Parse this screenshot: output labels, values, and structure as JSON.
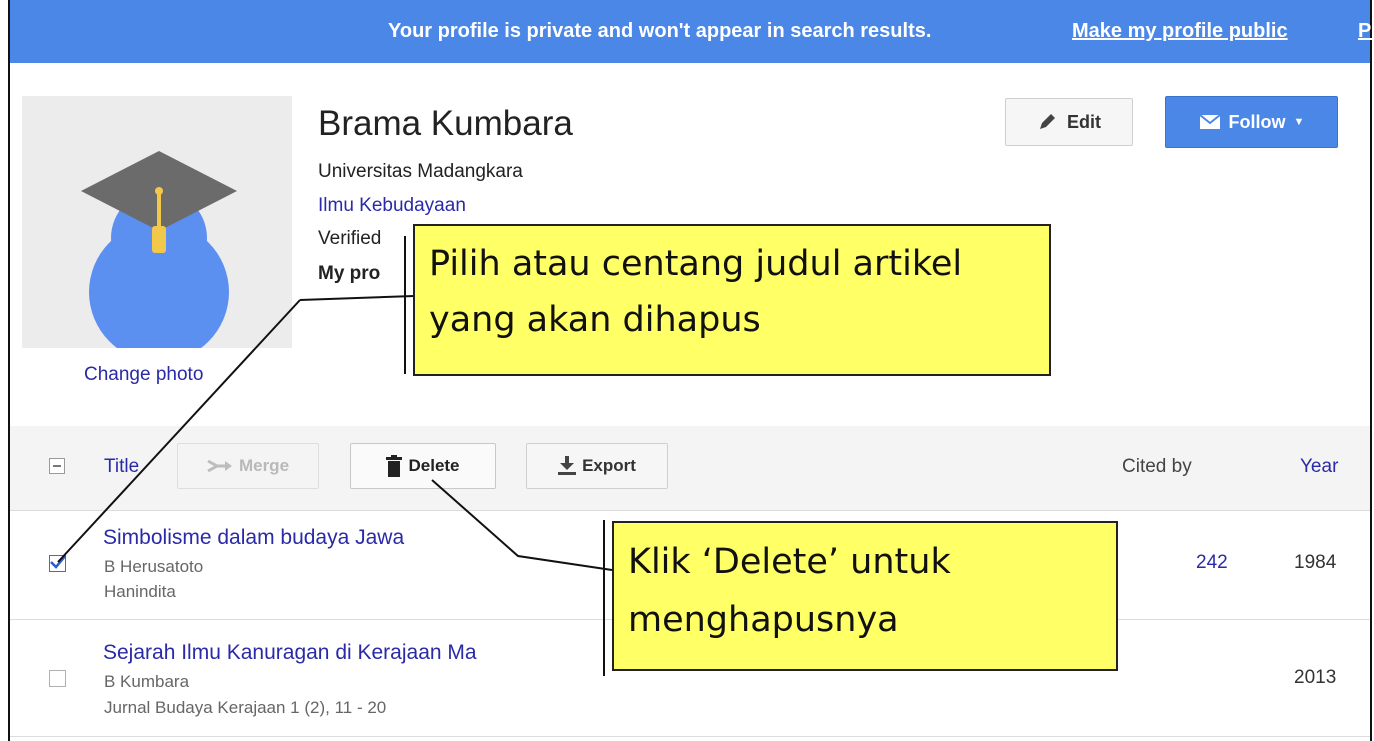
{
  "banner": {
    "message": "Your profile is private and won't appear in search results.",
    "make_public": "Make my profile public",
    "cut_link": "Pr"
  },
  "profile": {
    "name": "Brama Kumbara",
    "affiliation": "Universitas Madangkara",
    "field": "Ilmu Kebudayaan",
    "verified": "Verified",
    "my_profile": "My pro",
    "change_photo": "Change photo"
  },
  "actions": {
    "edit": "Edit",
    "follow": "Follow"
  },
  "table": {
    "col_title": "Title",
    "merge": "Merge",
    "delete": "Delete",
    "export": "Export",
    "col_cited": "Cited by",
    "col_year": "Year",
    "rows": [
      {
        "title": "Simbolisme dalam budaya Jawa",
        "authors": "B Herusatoto",
        "publication": "Hanindita",
        "cited": "242",
        "year": "1984",
        "checked": true
      },
      {
        "title": "Sejarah Ilmu Kanuragan di Kerajaan Ma",
        "authors": "B Kumbara",
        "publication": "Jurnal Budaya Kerajaan 1 (2), 11 - 20",
        "cited": "",
        "year": "2013",
        "checked": false
      }
    ]
  },
  "callouts": {
    "select": {
      "line1": "Pilih atau centang judul artikel",
      "line2": "yang akan dihapus"
    },
    "delete": {
      "line1": "Klik ‘Delete’ untuk",
      "line2": "menghapusnya"
    }
  },
  "colors": {
    "banner_bg": "#4a87e6",
    "link": "#2a2aa8",
    "callout_bg": "#ffff66",
    "avatar_blue": "#5b8ff0",
    "cap_gray": "#6b6b6b",
    "tassel": "#f2c84b"
  },
  "icons": {
    "edit": "pencil-icon",
    "follow": "envelope-icon",
    "follow_menu": "caret-down-icon",
    "merge": "merge-arrow-icon",
    "delete": "trash-icon",
    "export": "download-icon",
    "header_checkbox": "minus-checkbox-icon",
    "row_checked": "checkmark-icon"
  }
}
